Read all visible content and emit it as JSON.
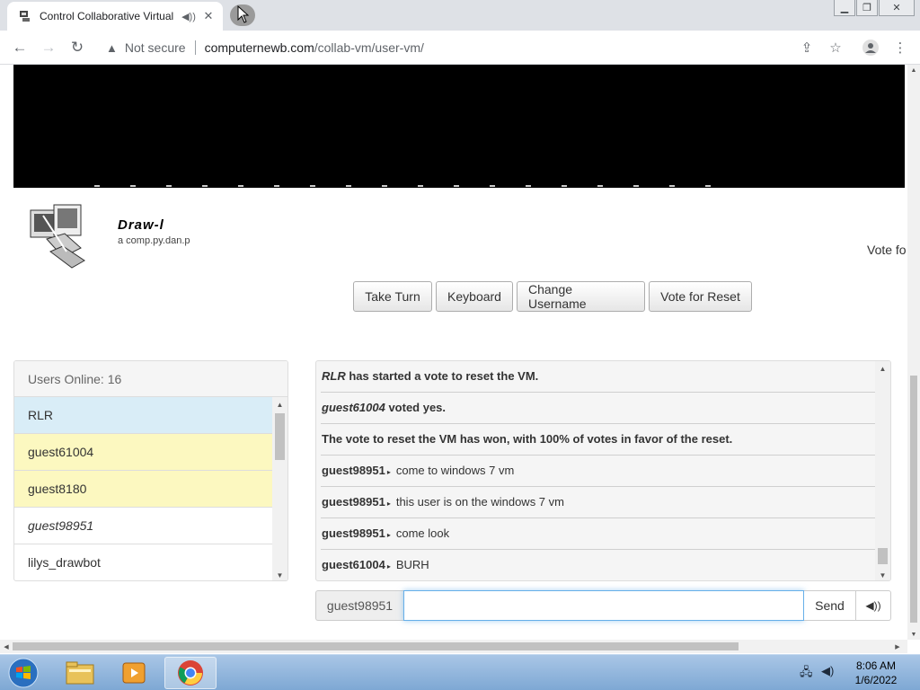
{
  "browser": {
    "tab_title": "Control Collaborative Virtual",
    "security_label": "Not secure",
    "url_host": "computernewb.com",
    "url_path": "/collab-vm/user-vm/"
  },
  "vm": {
    "name": "Draw-l",
    "description": "a comp.py.dan.p",
    "vote_status": "Vote fo"
  },
  "actions": {
    "take_turn": "Take Turn",
    "keyboard": "Keyboard",
    "change_username": "Change Username",
    "vote_reset": "Vote for Reset"
  },
  "users": {
    "header": "Users Online: 16",
    "items": [
      {
        "name": "RLR",
        "state": "owner"
      },
      {
        "name": "guest61004",
        "state": "turn"
      },
      {
        "name": "guest8180",
        "state": "turn"
      },
      {
        "name": "guest98951",
        "state": "me"
      },
      {
        "name": "lilys_drawbot",
        "state": "normal"
      }
    ]
  },
  "chat": {
    "messages": [
      {
        "type": "sys",
        "who": "RLR",
        "text": " has started a vote to reset the VM."
      },
      {
        "type": "sys",
        "who": "guest61004",
        "text": " voted yes."
      },
      {
        "type": "sys",
        "who": "",
        "text": "The vote to reset the VM has won, with 100% of votes in favor of the reset."
      },
      {
        "type": "user",
        "who": "guest98951",
        "text": "come to windows 7 vm"
      },
      {
        "type": "user",
        "who": "guest98951",
        "text": "this user is on the windows 7 vm"
      },
      {
        "type": "user",
        "who": "guest98951",
        "text": "come look"
      },
      {
        "type": "user",
        "who": "guest61004",
        "text": "BURH"
      }
    ],
    "username": "guest98951",
    "input_value": "",
    "send_label": "Send"
  },
  "taskbar": {
    "time": "8:06 AM",
    "date": "1/6/2022"
  }
}
